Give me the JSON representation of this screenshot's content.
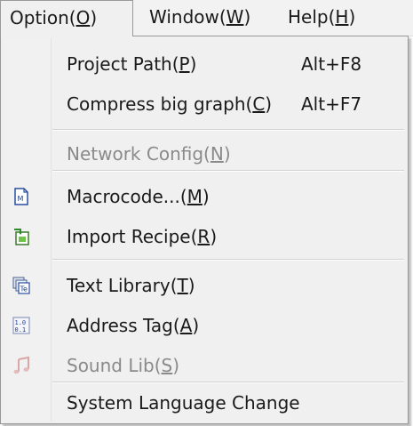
{
  "menubar": {
    "items": [
      {
        "label": "Option(",
        "key": "O",
        "suffix": ")"
      },
      {
        "label": "Window(",
        "key": "W",
        "suffix": ")"
      },
      {
        "label": "Help(",
        "key": "H",
        "suffix": ")"
      }
    ]
  },
  "menu": {
    "items": [
      {
        "label": "Project Path(",
        "key": "P",
        "suffix": ")",
        "shortcut": "Alt+F8"
      },
      {
        "label": "Compress big graph(",
        "key": "C",
        "suffix": ")",
        "shortcut": "Alt+F7"
      },
      {
        "label": "Network Config(",
        "key": "N",
        "suffix": ")",
        "disabled": true
      },
      {
        "label": "Macrocode...(",
        "key": "M",
        "suffix": ")",
        "icon": "macrocode-icon"
      },
      {
        "label": "Import Recipe(",
        "key": "R",
        "suffix": ")",
        "icon": "import-recipe-icon"
      },
      {
        "label": "Text Library(",
        "key": "T",
        "suffix": ")",
        "icon": "text-library-icon"
      },
      {
        "label": "Address Tag(",
        "key": "A",
        "suffix": ")",
        "icon": "address-tag-icon"
      },
      {
        "label": "Sound Lib(",
        "key": "S",
        "suffix": ")",
        "disabled": true,
        "icon": "sound-lib-icon"
      },
      {
        "label": "System Language Change"
      }
    ]
  }
}
